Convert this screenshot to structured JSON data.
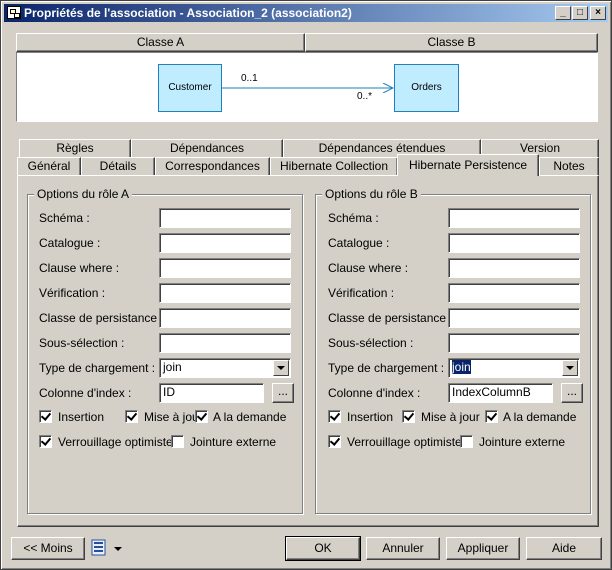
{
  "window": {
    "title": "Propriétés de l'association - Association_2 (association2)",
    "controls": [
      "_",
      "□",
      "×"
    ]
  },
  "classes": {
    "a_header": "Classe A",
    "b_header": "Classe B",
    "entity_a": "Customer",
    "entity_b": "Orders",
    "mult_a": "0..1",
    "mult_b": "0..*"
  },
  "tabs_row1": [
    "Règles",
    "Dépendances",
    "Dépendances étendues",
    "Version"
  ],
  "tabs_row2": [
    "Général",
    "Détails",
    "Correspondances",
    "Hibernate Collection",
    "Hibernate Persistence",
    "Notes"
  ],
  "active_tab": "Hibernate Persistence",
  "role_a": {
    "legend": "Options du rôle A",
    "labels": {
      "schema": "Schéma :",
      "catalogue": "Catalogue :",
      "where": "Clause where :",
      "verification": "Vérification :",
      "classe": "Classe de persistance :",
      "sous": "Sous-sélection :",
      "type": "Type de chargement :",
      "index": "Colonne d'index :"
    },
    "values": {
      "schema": "",
      "catalogue": "",
      "where": "",
      "verification": "",
      "classe": "",
      "sous": "",
      "type": "join",
      "index": "ID"
    },
    "browse_label": "...",
    "checks": {
      "insertion": {
        "label": "Insertion",
        "checked": true
      },
      "mise": {
        "label": "Mise à jour",
        "checked": true
      },
      "demande": {
        "label": "A la demande",
        "checked": true
      },
      "verrou": {
        "label": "Verrouillage optimiste",
        "checked": true
      },
      "jointure": {
        "label": "Jointure externe",
        "checked": false
      }
    }
  },
  "role_b": {
    "legend": "Options du rôle B",
    "labels": {
      "schema": "Schéma :",
      "catalogue": "Catalogue :",
      "where": "Clause where :",
      "verification": "Vérification :",
      "classe": "Classe de persistance :",
      "sous": "Sous-sélection :",
      "type": "Type de chargement :",
      "index": "Colonne d'index :"
    },
    "values": {
      "schema": "",
      "catalogue": "",
      "where": "",
      "verification": "",
      "classe": "",
      "sous": "",
      "type": "join",
      "index": "IndexColumnB"
    },
    "browse_label": "...",
    "checks": {
      "insertion": {
        "label": "Insertion",
        "checked": true
      },
      "mise": {
        "label": "Mise à jour",
        "checked": true
      },
      "demande": {
        "label": "A la demande",
        "checked": true
      },
      "verrou": {
        "label": "Verrouillage optimiste",
        "checked": true
      },
      "jointure": {
        "label": "Jointure externe",
        "checked": false
      }
    }
  },
  "footer": {
    "moins": "<< Moins",
    "ok": "OK",
    "annuler": "Annuler",
    "appliquer": "Appliquer",
    "aide": "Aide"
  }
}
